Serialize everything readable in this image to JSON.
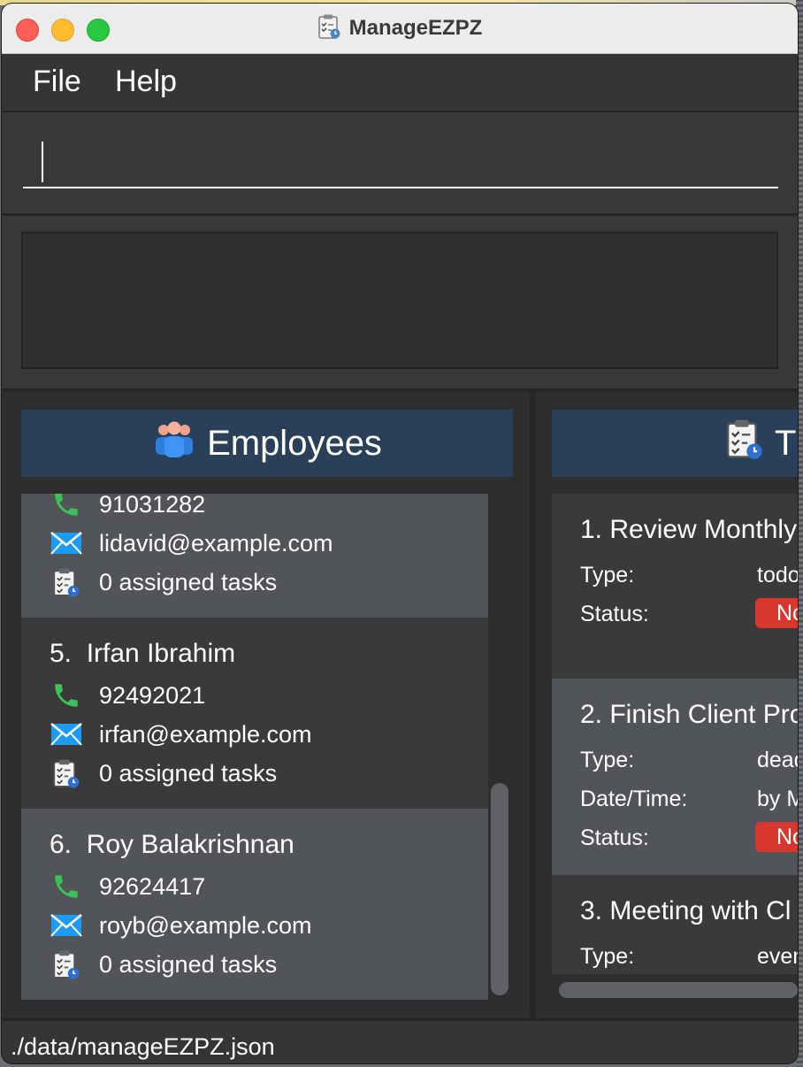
{
  "window": {
    "title": "ManageEZPZ"
  },
  "menu": {
    "file": "File",
    "help": "Help"
  },
  "command_box": {
    "value": "",
    "placeholder": ""
  },
  "result_display": {
    "text": ""
  },
  "employees_pane": {
    "header": "Employees",
    "partial_card": {
      "phone": "91031282",
      "email": "lidavid@example.com",
      "tasks": "0 assigned tasks"
    },
    "cards": [
      {
        "index": "5.",
        "name": "Irfan Ibrahim",
        "phone": "92492021",
        "email": "irfan@example.com",
        "tasks": "0 assigned tasks"
      },
      {
        "index": "6.",
        "name": "Roy Balakrishnan",
        "phone": "92624417",
        "email": "royb@example.com",
        "tasks": "0 assigned tasks"
      }
    ]
  },
  "tasks_pane": {
    "header": "T",
    "type_label": "Type:",
    "status_label": "Status:",
    "datetime_label": "Date/Time:",
    "tasks": [
      {
        "title": "1.  Review Monthly",
        "type": "todo",
        "status": "No"
      },
      {
        "title": "2.  Finish Client Pro",
        "type": "dead",
        "datetime": "by M",
        "status": "No"
      },
      {
        "title": "3.  Meeting with Cl",
        "type": "even"
      }
    ]
  },
  "status_bar": {
    "path": "./data/manageEZPZ.json"
  },
  "colors": {
    "background": "#2e2e2e",
    "header_blue": "#2a4058",
    "card_light": "#515559",
    "card_dark": "#3a3a3a",
    "status_red": "#d9372d",
    "phone_green": "#3dbf5a",
    "email_blue": "#1d9bf0"
  },
  "icons": {
    "phone": "phone-icon",
    "email": "email-icon",
    "tasks": "clipboard-clock-icon",
    "employees": "people-icon"
  }
}
